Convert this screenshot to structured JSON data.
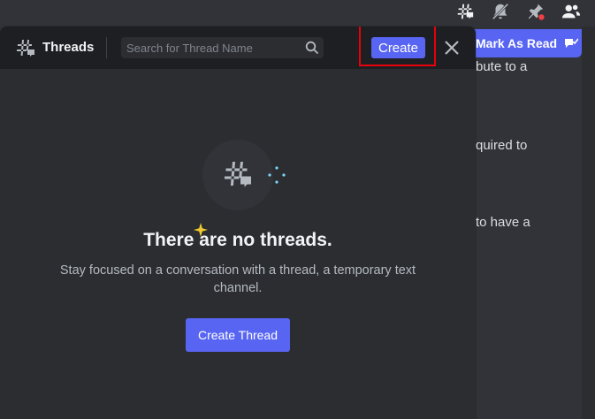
{
  "toolbar_icons": [
    "threads-icon",
    "notifications-muted-icon",
    "pinned-messages-icon",
    "member-list-icon"
  ],
  "channel_banner": {
    "mark_read_label": "Mark As Read"
  },
  "background_text": [
    "bute to a",
    "quired to",
    "to have a"
  ],
  "threads_panel": {
    "title": "Threads",
    "search_placeholder": "Search for Thread Name",
    "create_label": "Create",
    "empty_title": "There are no threads.",
    "empty_description": "Stay focused on a conversation with a thread, a temporary text channel.",
    "create_thread_label": "Create Thread"
  },
  "colors": {
    "accent": "#5865f2",
    "highlight": "#e8000b",
    "sparkle_yellow": "#f0c92f",
    "sparkle_blue": "#7bd3f7"
  }
}
